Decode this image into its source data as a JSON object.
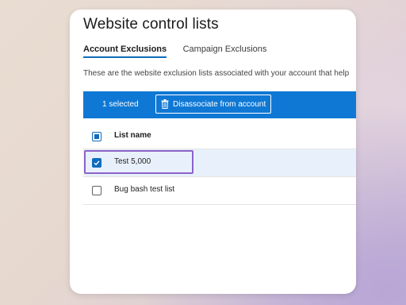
{
  "page": {
    "title": "Website control lists"
  },
  "tabs": [
    {
      "label": "Account Exclusions",
      "active": true
    },
    {
      "label": "Campaign Exclusions",
      "active": false
    }
  ],
  "description": "These are the website exclusion lists associated with your account that help",
  "action_bar": {
    "selected_text": "1 selected",
    "disassociate_label": "Disassociate from account",
    "icon": "trash-icon"
  },
  "table": {
    "column_header": "List name",
    "rows": [
      {
        "name": "Test 5,000",
        "checked": true
      },
      {
        "name": "Bug bash test list",
        "checked": false
      }
    ]
  },
  "colors": {
    "accent": "#0f78d4",
    "focus": "#8c63c9",
    "selected_row": "#e8f1fb"
  }
}
